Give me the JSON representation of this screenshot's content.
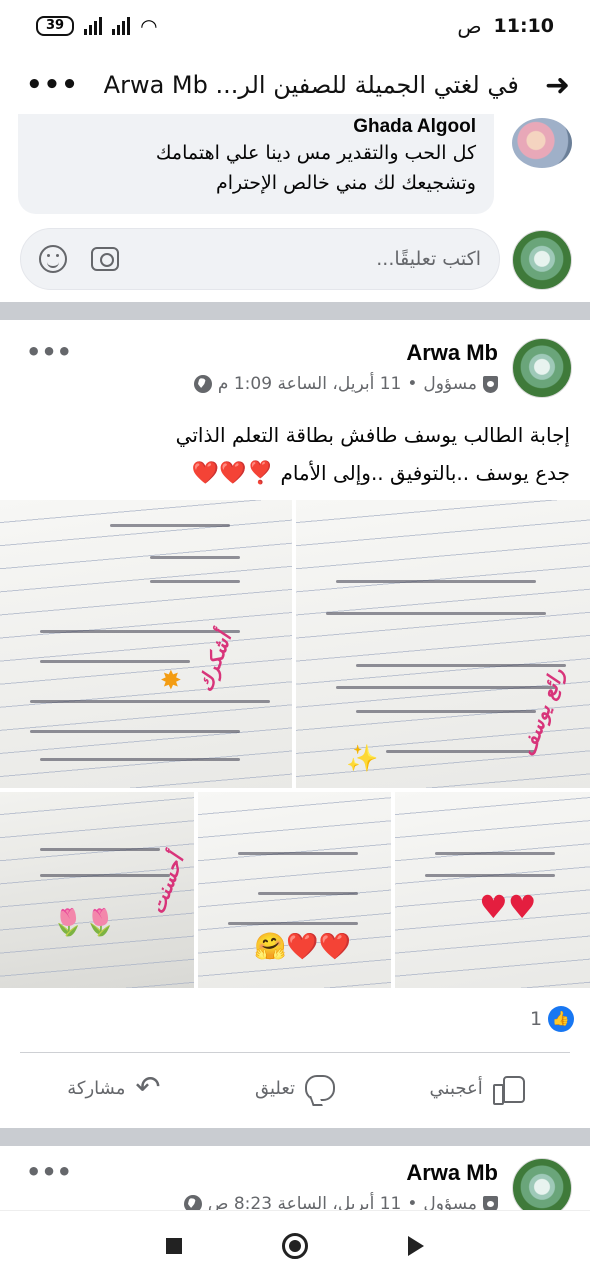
{
  "status_bar": {
    "time": "11:10",
    "am_pm": "ص",
    "battery": "39"
  },
  "header": {
    "title": "في لغتي الجميلة للصفين الر... Arwa Mb",
    "back_icon": "arrow-right-icon",
    "more_icon": "more-dots-icon"
  },
  "comment": {
    "author": "Ghada Algool",
    "text_line1": "كل الحب  والتقدير  مس دينا علي اهتمامك",
    "text_line2": "وتشجيعك لك مني خالص الإحترام"
  },
  "comment_input": {
    "placeholder": "اكتب تعليقًا..."
  },
  "post": {
    "author": "Arwa Mb",
    "role": "مسؤول",
    "date": "11 أبريل، الساعة 1:09 م",
    "text_line1": "إجابة الطالب يوسف طافش بطاقة التعلم الذاتي",
    "text_line2": "جدع يوسف ..بالتوفيق ..وإلى الأمام",
    "hearts": "❣️❤️❤️",
    "photo_captions": [
      "أشكرك",
      "رائع يوسف",
      "أحسنت"
    ],
    "reaction_count": "1",
    "actions": {
      "like": "أعجبني",
      "comment": "تعليق",
      "share": "مشاركة"
    }
  },
  "post2": {
    "author": "Arwa Mb",
    "role": "مسؤول",
    "date": "11 أبريل، الساعة 8:23 ص"
  },
  "colors": {
    "accent": "#1877f2",
    "heart": "#e41e3f",
    "secondary_text": "#65676b",
    "divider": "#c9ccd1"
  }
}
